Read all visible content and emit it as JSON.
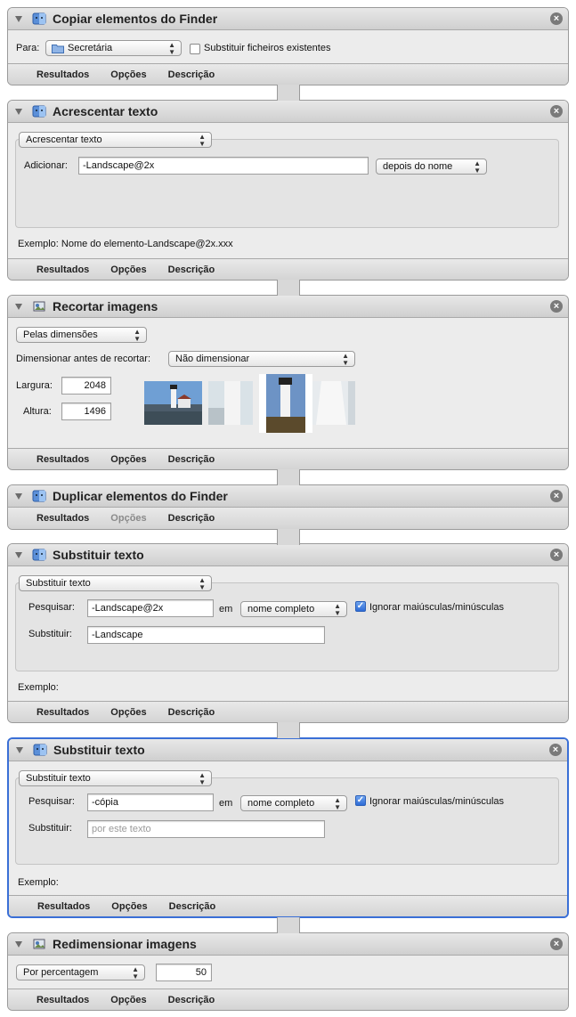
{
  "common_tabs": {
    "results": "Resultados",
    "options": "Opções",
    "description": "Descrição"
  },
  "actions": [
    {
      "title": "Copiar elementos do Finder",
      "to_label": "Para:",
      "to_value": "Secretária",
      "replace_label": "Substituir ficheiros existentes",
      "replace_checked": false
    },
    {
      "title": "Acrescentar texto",
      "mode_value": "Acrescentar texto",
      "add_label": "Adicionar:",
      "add_value": "-Landscape@2x",
      "position_value": "depois do nome",
      "example": "Exemplo: Nome do elemento-Landscape@2x.xxx"
    },
    {
      "title": "Recortar imagens",
      "mode_value": "Pelas dimensões",
      "scale_label": "Dimensionar antes de recortar:",
      "scale_value": "Não dimensionar",
      "width_label": "Largura:",
      "width_value": "2048",
      "height_label": "Altura:",
      "height_value": "1496"
    },
    {
      "title": "Duplicar elementos do Finder",
      "options_disabled": true
    },
    {
      "title": "Substituir texto",
      "mode_value": "Substituir texto",
      "find_label": "Pesquisar:",
      "find_value": "-Landscape@2x",
      "in_label": "em",
      "in_value": "nome completo",
      "ignore_case_label": "Ignorar maiúsculas/minúsculas",
      "ignore_case_checked": true,
      "replace_label": "Substituir:",
      "replace_value": "-Landscape",
      "example": "Exemplo:"
    },
    {
      "title": "Substituir texto",
      "mode_value": "Substituir texto",
      "find_label": "Pesquisar:",
      "find_value": "-cópia",
      "in_label": "em",
      "in_value": "nome completo",
      "ignore_case_label": "Ignorar maiúsculas/minúsculas",
      "ignore_case_checked": true,
      "replace_label": "Substituir:",
      "replace_placeholder": "por este texto",
      "example": "Exemplo:",
      "selected": true
    },
    {
      "title": "Redimensionar imagens",
      "mode_value": "Por percentagem",
      "percent_value": "50"
    }
  ],
  "colors": {
    "selection": "#3a6fd6",
    "checkbox": "#2d6bd6"
  }
}
